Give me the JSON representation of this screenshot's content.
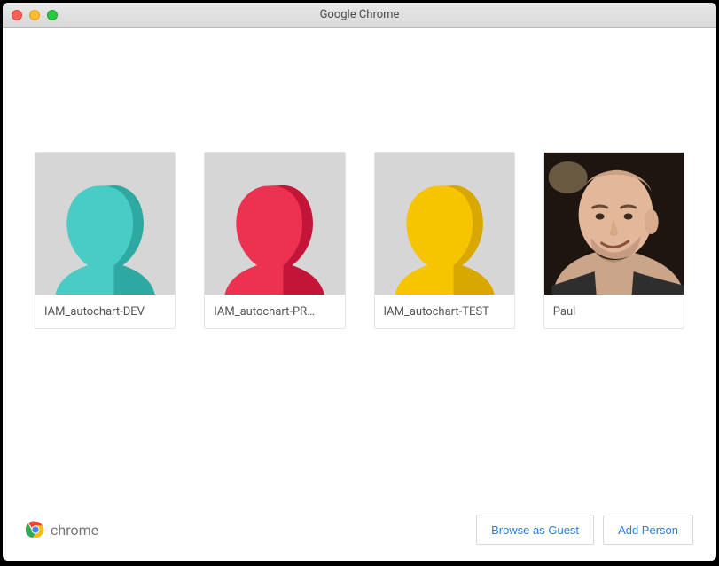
{
  "window": {
    "title": "Google Chrome"
  },
  "profiles": [
    {
      "label": "IAM_autochart-DEV",
      "avatar_color": "#49ccc6",
      "avatar_shadow": "#2da9a2",
      "type": "silhouette"
    },
    {
      "label": "IAM_autochart-PR…",
      "avatar_color": "#ed3151",
      "avatar_shadow": "#c31537",
      "type": "silhouette"
    },
    {
      "label": "IAM_autochart-TEST",
      "avatar_color": "#f7c500",
      "avatar_shadow": "#d9a800",
      "type": "silhouette"
    },
    {
      "label": "Paul",
      "type": "photo"
    }
  ],
  "brand": {
    "text": "chrome"
  },
  "footer": {
    "browse_guest": "Browse as Guest",
    "add_person": "Add Person"
  }
}
